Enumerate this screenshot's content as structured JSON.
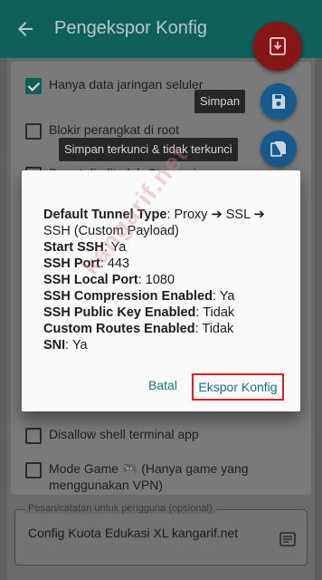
{
  "appbar": {
    "title": "Pengekspor Konfig",
    "back_icon": "arrow-left-icon"
  },
  "options": [
    {
      "label": "Hanya data jaringan seluler",
      "checked": true
    },
    {
      "label": "Blokir perangkat di root",
      "checked": false
    },
    {
      "label": "Dapat diedit oleh Ctam-roip",
      "checked": false
    },
    {
      "label": "",
      "checked": false
    },
    {
      "label": "",
      "checked": false
    },
    {
      "label": "",
      "checked": false
    },
    {
      "label": "",
      "checked": false
    },
    {
      "label": "",
      "checked": false
    },
    {
      "label": "",
      "checked": false
    },
    {
      "label": "Disallow shell terminal app",
      "checked": false
    },
    {
      "label": "Mode Game 🎮 (Hanya game yang menggunakan VPN)",
      "checked": false
    }
  ],
  "notes": {
    "legend": "Pesan/catatan untuk pengguna (opsional)",
    "value": "Config Kuota Edukasi XL kangarif.net"
  },
  "fab": {
    "save_tooltip": "Simpan",
    "locked_tooltip": "Simpan terkunci & tidak terkunci"
  },
  "dialog": {
    "lines": [
      {
        "key": "Default Tunnel Type",
        "value": ": Proxy ➔ SSL ➔ SSH (Custom Payload)"
      },
      {
        "key": "Start SSH",
        "value": ": Ya"
      },
      {
        "key": "SSH Port",
        "value": ": 443"
      },
      {
        "key": "SSH Local Port",
        "value": ": 1080"
      },
      {
        "key": "SSH Compression Enabled",
        "value": ": Ya"
      },
      {
        "key": "SSH Public Key Enabled",
        "value": ": Tidak"
      },
      {
        "key": "Custom Routes Enabled",
        "value": ": Tidak"
      },
      {
        "key": "SNI",
        "value": ": Ya"
      }
    ],
    "cancel_label": "Batal",
    "export_label": "Ekspor Konfig"
  },
  "watermark": "kangarif.net",
  "colors": {
    "appbar": "#0f5f5b",
    "fab_main": "#861515",
    "fab_mini": "#175a8e",
    "accent_text": "#1a6f8c",
    "highlight_border": "#e0201e"
  }
}
